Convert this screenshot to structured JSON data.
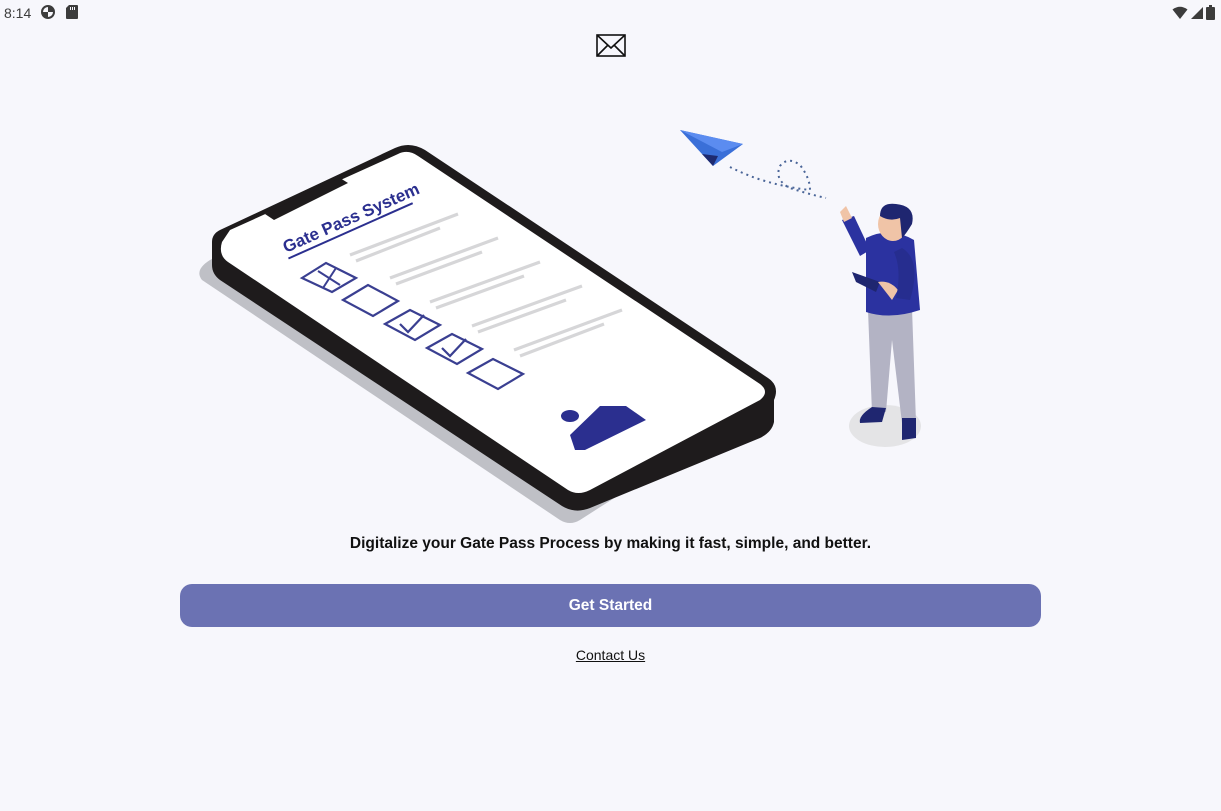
{
  "status_bar": {
    "time": "8:14",
    "left_icons": [
      "data-saver-icon",
      "sd-card-icon"
    ],
    "right_icons": [
      "wifi-icon",
      "cell-signal-icon",
      "battery-icon"
    ]
  },
  "header": {
    "logo_icon": "broken-image-icon"
  },
  "illustration": {
    "phone_screen_title": "Gate Pass System"
  },
  "main": {
    "tagline": "Digitalize your Gate Pass Process by making it fast, simple, and better.",
    "primary_button_label": "Get Started",
    "contact_link_label": "Contact Us"
  },
  "colors": {
    "background": "#f7f7fc",
    "primary_button": "#6b72b3",
    "accent_navy": "#2b2f8f"
  }
}
